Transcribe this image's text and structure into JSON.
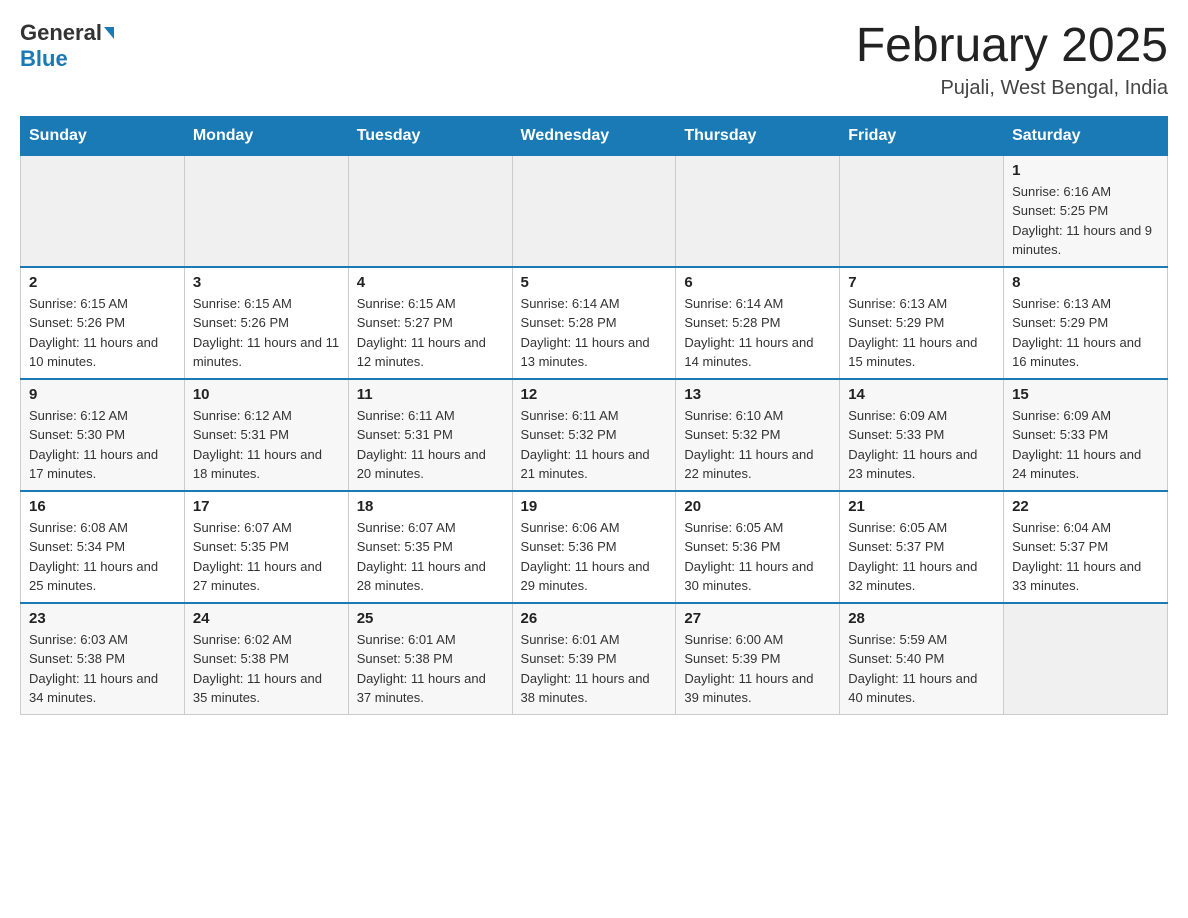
{
  "header": {
    "logo_general": "General",
    "logo_blue": "Blue",
    "month_title": "February 2025",
    "location": "Pujali, West Bengal, India"
  },
  "weekdays": [
    "Sunday",
    "Monday",
    "Tuesday",
    "Wednesday",
    "Thursday",
    "Friday",
    "Saturday"
  ],
  "weeks": [
    {
      "days": [
        {
          "num": "",
          "info": ""
        },
        {
          "num": "",
          "info": ""
        },
        {
          "num": "",
          "info": ""
        },
        {
          "num": "",
          "info": ""
        },
        {
          "num": "",
          "info": ""
        },
        {
          "num": "",
          "info": ""
        },
        {
          "num": "1",
          "info": "Sunrise: 6:16 AM\nSunset: 5:25 PM\nDaylight: 11 hours and 9 minutes."
        }
      ]
    },
    {
      "days": [
        {
          "num": "2",
          "info": "Sunrise: 6:15 AM\nSunset: 5:26 PM\nDaylight: 11 hours and 10 minutes."
        },
        {
          "num": "3",
          "info": "Sunrise: 6:15 AM\nSunset: 5:26 PM\nDaylight: 11 hours and 11 minutes."
        },
        {
          "num": "4",
          "info": "Sunrise: 6:15 AM\nSunset: 5:27 PM\nDaylight: 11 hours and 12 minutes."
        },
        {
          "num": "5",
          "info": "Sunrise: 6:14 AM\nSunset: 5:28 PM\nDaylight: 11 hours and 13 minutes."
        },
        {
          "num": "6",
          "info": "Sunrise: 6:14 AM\nSunset: 5:28 PM\nDaylight: 11 hours and 14 minutes."
        },
        {
          "num": "7",
          "info": "Sunrise: 6:13 AM\nSunset: 5:29 PM\nDaylight: 11 hours and 15 minutes."
        },
        {
          "num": "8",
          "info": "Sunrise: 6:13 AM\nSunset: 5:29 PM\nDaylight: 11 hours and 16 minutes."
        }
      ]
    },
    {
      "days": [
        {
          "num": "9",
          "info": "Sunrise: 6:12 AM\nSunset: 5:30 PM\nDaylight: 11 hours and 17 minutes."
        },
        {
          "num": "10",
          "info": "Sunrise: 6:12 AM\nSunset: 5:31 PM\nDaylight: 11 hours and 18 minutes."
        },
        {
          "num": "11",
          "info": "Sunrise: 6:11 AM\nSunset: 5:31 PM\nDaylight: 11 hours and 20 minutes."
        },
        {
          "num": "12",
          "info": "Sunrise: 6:11 AM\nSunset: 5:32 PM\nDaylight: 11 hours and 21 minutes."
        },
        {
          "num": "13",
          "info": "Sunrise: 6:10 AM\nSunset: 5:32 PM\nDaylight: 11 hours and 22 minutes."
        },
        {
          "num": "14",
          "info": "Sunrise: 6:09 AM\nSunset: 5:33 PM\nDaylight: 11 hours and 23 minutes."
        },
        {
          "num": "15",
          "info": "Sunrise: 6:09 AM\nSunset: 5:33 PM\nDaylight: 11 hours and 24 minutes."
        }
      ]
    },
    {
      "days": [
        {
          "num": "16",
          "info": "Sunrise: 6:08 AM\nSunset: 5:34 PM\nDaylight: 11 hours and 25 minutes."
        },
        {
          "num": "17",
          "info": "Sunrise: 6:07 AM\nSunset: 5:35 PM\nDaylight: 11 hours and 27 minutes."
        },
        {
          "num": "18",
          "info": "Sunrise: 6:07 AM\nSunset: 5:35 PM\nDaylight: 11 hours and 28 minutes."
        },
        {
          "num": "19",
          "info": "Sunrise: 6:06 AM\nSunset: 5:36 PM\nDaylight: 11 hours and 29 minutes."
        },
        {
          "num": "20",
          "info": "Sunrise: 6:05 AM\nSunset: 5:36 PM\nDaylight: 11 hours and 30 minutes."
        },
        {
          "num": "21",
          "info": "Sunrise: 6:05 AM\nSunset: 5:37 PM\nDaylight: 11 hours and 32 minutes."
        },
        {
          "num": "22",
          "info": "Sunrise: 6:04 AM\nSunset: 5:37 PM\nDaylight: 11 hours and 33 minutes."
        }
      ]
    },
    {
      "days": [
        {
          "num": "23",
          "info": "Sunrise: 6:03 AM\nSunset: 5:38 PM\nDaylight: 11 hours and 34 minutes."
        },
        {
          "num": "24",
          "info": "Sunrise: 6:02 AM\nSunset: 5:38 PM\nDaylight: 11 hours and 35 minutes."
        },
        {
          "num": "25",
          "info": "Sunrise: 6:01 AM\nSunset: 5:38 PM\nDaylight: 11 hours and 37 minutes."
        },
        {
          "num": "26",
          "info": "Sunrise: 6:01 AM\nSunset: 5:39 PM\nDaylight: 11 hours and 38 minutes."
        },
        {
          "num": "27",
          "info": "Sunrise: 6:00 AM\nSunset: 5:39 PM\nDaylight: 11 hours and 39 minutes."
        },
        {
          "num": "28",
          "info": "Sunrise: 5:59 AM\nSunset: 5:40 PM\nDaylight: 11 hours and 40 minutes."
        },
        {
          "num": "",
          "info": ""
        }
      ]
    }
  ]
}
